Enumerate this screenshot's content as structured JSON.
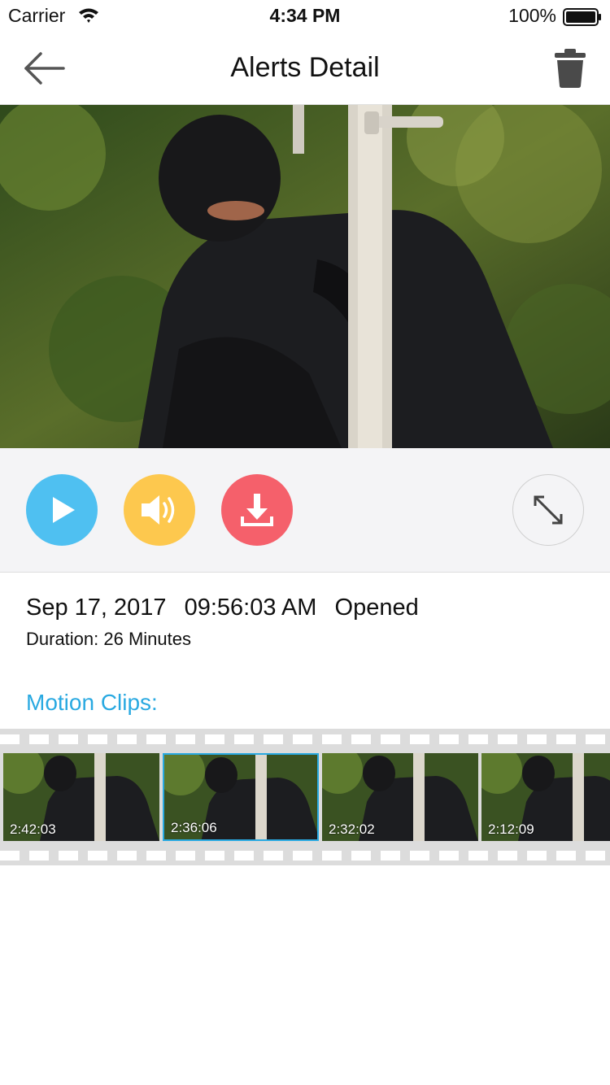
{
  "status_bar": {
    "carrier": "Carrier",
    "time": "4:34 PM",
    "battery": "100%"
  },
  "nav": {
    "title": "Alerts Detail",
    "back_icon": "arrow-left-icon",
    "trash_icon": "trash-icon"
  },
  "controls": {
    "play_icon": "play-icon",
    "sound_icon": "speaker-icon",
    "download_icon": "download-icon",
    "expand_icon": "expand-icon",
    "colors": {
      "play": "#4fc0f1",
      "sound": "#fdc84e",
      "download": "#f5606b"
    }
  },
  "alert": {
    "date": "Sep 17, 2017",
    "time": "09:56:03 AM",
    "status": "Opened",
    "duration": "Duration: 26 Minutes"
  },
  "clips": {
    "label": "Motion Clips:",
    "accent": "#29a9e1",
    "items": [
      {
        "time": "2:42:03",
        "selected": false
      },
      {
        "time": "2:36:06",
        "selected": true
      },
      {
        "time": "2:32:02",
        "selected": false
      },
      {
        "time": "2:12:09",
        "selected": false
      }
    ]
  }
}
